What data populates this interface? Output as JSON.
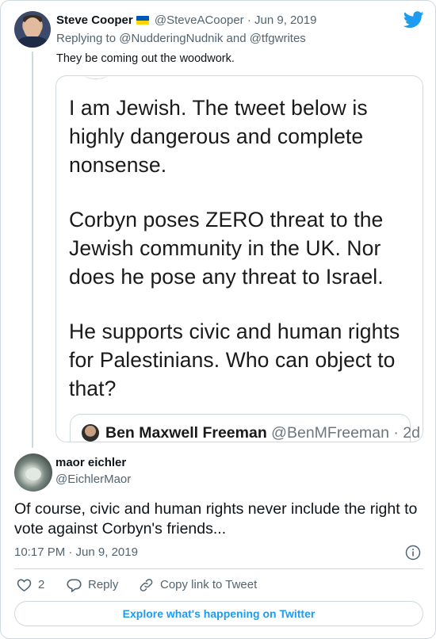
{
  "parent_tweet": {
    "name": "Steve Cooper",
    "flag_icon": "ukraine-flag-icon",
    "handle": "@SteveACooper",
    "separator": "·",
    "date": "Jun 9, 2019",
    "replying_to": "Replying to @NudderingNudnik and @tfgwrites",
    "text": "They be coming out the woodwork."
  },
  "embedded_screenshot": {
    "paragraph_1": "I am Jewish. The tweet below is highly dangerous and complete nonsense.",
    "paragraph_2": "Corbyn poses ZERO threat to the Jewish community in the UK. Nor does he pose any threat to Israel.",
    "paragraph_3": "He supports civic and human rights for Palestinians. Who can object to that?",
    "quoted_name": "Ben Maxwell Freeman",
    "quoted_handle": "@BenMFreeman",
    "quoted_time": "· 2d"
  },
  "main_tweet": {
    "name": "maor eichler",
    "handle": "@EichlerMaor",
    "text": "Of course, civic and human rights never include the right to vote against Corbyn's friends...",
    "time": "10:17 PM · Jun 9, 2019"
  },
  "actions": {
    "like_count": "2",
    "reply_label": "Reply",
    "copy_label": "Copy link to Tweet"
  },
  "footer": {
    "explore_label": "Explore what's happening on Twitter"
  },
  "colors": {
    "accent": "#1d9bf0",
    "muted": "#536471",
    "border": "#cfd9de"
  }
}
